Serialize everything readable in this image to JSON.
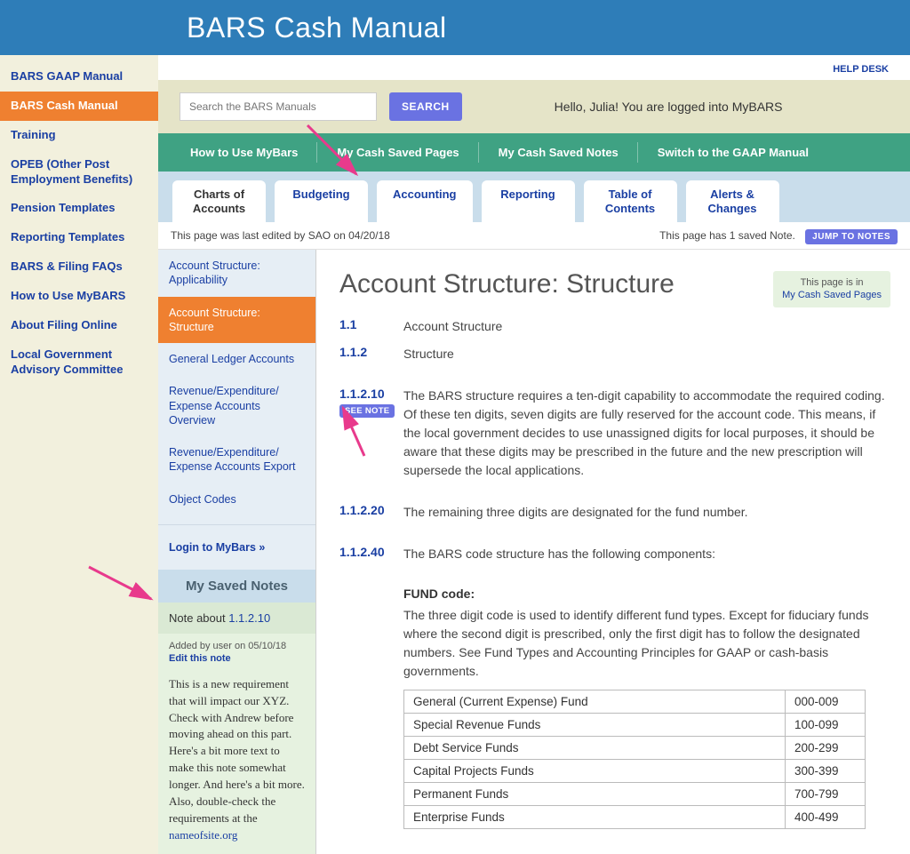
{
  "banner_title": "BARS Cash Manual",
  "helpdesk_label": "HELP DESK",
  "left_nav": [
    "BARS GAAP Manual",
    "BARS Cash Manual",
    "Training",
    "OPEB (Other Post Employment Benefits)",
    "Pension Templates",
    "Reporting Templates",
    "BARS & Filing FAQs",
    "How to Use MyBARS",
    "About Filing Online",
    "Local Government Advisory Committee"
  ],
  "left_nav_active_index": 1,
  "search": {
    "placeholder": "Search the BARS Manuals",
    "button": "SEARCH"
  },
  "greeting": "Hello, Julia! You are logged into MyBARS",
  "teal_nav": [
    "How to Use MyBars",
    "My Cash Saved Pages",
    "My Cash Saved Notes",
    "Switch to the GAAP Manual"
  ],
  "tabs": [
    {
      "l1": "Charts of",
      "l2": "Accounts"
    },
    {
      "l1": "Budgeting",
      "l2": ""
    },
    {
      "l1": "Accounting",
      "l2": ""
    },
    {
      "l1": "Reporting",
      "l2": ""
    },
    {
      "l1": "Table of",
      "l2": "Contents"
    },
    {
      "l1": "Alerts &",
      "l2": "Changes"
    }
  ],
  "tabs_active_index": 0,
  "status": {
    "edited": "This page was last edited by SAO on 04/20/18",
    "notes": "This page has 1 saved Note.",
    "jump": "JUMP TO NOTES"
  },
  "sidebar2": [
    "Account Structure: Applicability",
    "Account Structure: Structure",
    "General Ledger Accounts",
    "Revenue/Expenditure/ Expense Accounts Overview",
    "Revenue/Expenditure/ Expense Accounts Export",
    "Object Codes"
  ],
  "sidebar2_active_index": 1,
  "sidebar2_login": "Login to MyBars »",
  "notes": {
    "header": "My Saved Notes",
    "title_prefix": "Note about ",
    "title_link": "1.1.2.10",
    "added": "Added by user on 05/10/18",
    "edit": "Edit this note",
    "body": "This is a new requirement that will impact our XYZ. Check with Andrew before moving ahead on this part. Here's a bit more text to make this note somewhat longer. And here's a bit more. Also, double-check the requirements at the ",
    "site": "nameofsite.org"
  },
  "page": {
    "title": "Account Structure: Structure",
    "badge_line1": "This page is in",
    "badge_link": "My Cash Saved Pages",
    "structure": [
      {
        "num": "1.1",
        "text": "Account Structure"
      },
      {
        "num": "1.1.2",
        "text": "Structure"
      }
    ],
    "paragraphs": [
      {
        "num": "1.1.2.10",
        "see_note": "SEE NOTE",
        "text": "The BARS structure requires a ten-digit capability to accommodate the required coding. Of these ten digits, seven digits are fully reserved for the account code. This means, if the local government decides to use unassigned digits for local purposes, it should be aware that these digits may be prescribed in the future and the new prescription will supersede the local applications."
      },
      {
        "num": "1.1.2.20",
        "text": "The remaining three digits are designated for the fund number."
      },
      {
        "num": "1.1.2.40",
        "text": "The BARS code structure has the following components:"
      }
    ],
    "fund_heading": "FUND code:",
    "fund_text": "The three digit code is used to identify different fund types. Except for fiduciary funds where the second digit is prescribed, only the first digit has to follow the designated numbers. See Fund Types and Accounting Principles for GAAP or cash-basis governments.",
    "fund_table": [
      [
        "General (Current Expense) Fund",
        "000-009"
      ],
      [
        "Special Revenue Funds",
        "100-099"
      ],
      [
        "Debt Service Funds",
        "200-299"
      ],
      [
        "Capital Projects Funds",
        "300-399"
      ],
      [
        "Permanent Funds",
        "700-799"
      ],
      [
        "Enterprise Funds",
        "400-499"
      ]
    ]
  }
}
